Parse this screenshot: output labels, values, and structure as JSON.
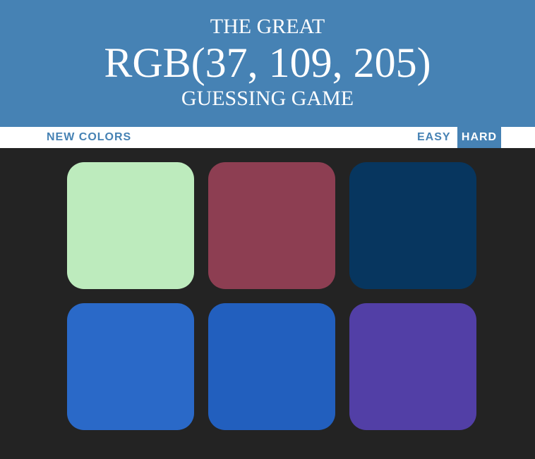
{
  "header": {
    "line1": "THE GREAT",
    "rgb_display": "RGB(37, 109, 205)",
    "line3": "GUESSING GAME",
    "background_color": "#4682b4"
  },
  "controls": {
    "new_colors_label": "NEW COLORS",
    "easy_label": "EASY",
    "hard_label": "HARD",
    "selected_mode": "HARD",
    "accent_color": "#4682b4"
  },
  "board": {
    "background_color": "#232323",
    "squares": [
      {
        "color": "#bdebbd"
      },
      {
        "color": "#8d3e52"
      },
      {
        "color": "#07365f"
      },
      {
        "color": "#2a69c8"
      },
      {
        "color": "#225fbe"
      },
      {
        "color": "#523fa6"
      }
    ]
  }
}
